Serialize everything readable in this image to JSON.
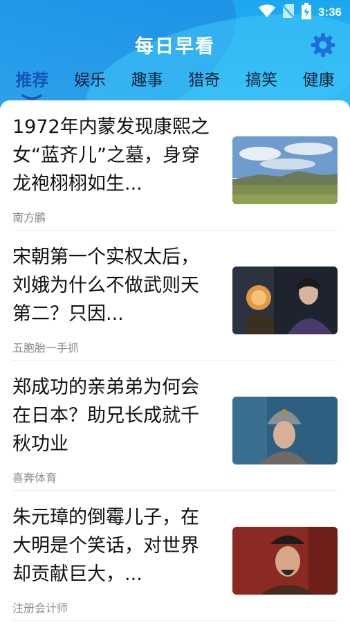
{
  "status_bar": {
    "time": "3:36",
    "icons": [
      "wifi-icon",
      "no-sim-icon",
      "battery-charging-icon"
    ]
  },
  "header": {
    "title": "每日早看",
    "settings_icon": "gear-icon"
  },
  "tabs": [
    {
      "label": "推荐",
      "active": true
    },
    {
      "label": "娱乐",
      "active": false
    },
    {
      "label": "趣事",
      "active": false
    },
    {
      "label": "猎奇",
      "active": false
    },
    {
      "label": "搞笑",
      "active": false
    },
    {
      "label": "健康",
      "active": false
    }
  ],
  "articles": [
    {
      "title": "1972年内蒙发现康熙之女“蓝齐儿”之墓，身穿龙袍栩栩如生...",
      "source": "南方鹏"
    },
    {
      "title": "宋朝第一个实权太后，刘娥为什么不做武则天第二？只因...",
      "source": "五胞胎一手抓"
    },
    {
      "title": "郑成功的亲弟弟为何会在日本？助兄长成就千秋功业",
      "source": "喜奔体育"
    },
    {
      "title": "朱元璋的倒霉儿子，在大明是个笑话，对世界却贡献巨大，...",
      "source": "注册会计师"
    }
  ],
  "colors": {
    "header_blue": "#1aa7ef",
    "active_tab": "#1456b8",
    "gear": "#1f6fd6"
  }
}
